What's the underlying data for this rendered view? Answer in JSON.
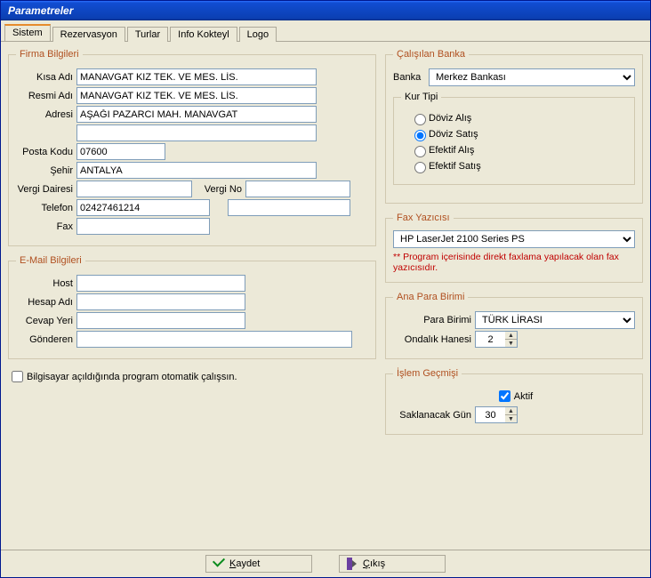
{
  "window": {
    "title": "Parametreler"
  },
  "tabs": [
    "Sistem",
    "Rezervasyon",
    "Turlar",
    "Info Kokteyl",
    "Logo"
  ],
  "firma": {
    "legend": "Firma Bilgileri",
    "labels": {
      "kisa_adi": "Kısa Adı",
      "resmi_adi": "Resmi Adı",
      "adresi": "Adresi",
      "posta_kodu": "Posta Kodu",
      "sehir": "Şehir",
      "vergi_dairesi": "Vergi Dairesi",
      "vergi_no": "Vergi No",
      "telefon": "Telefon",
      "fax": "Fax"
    },
    "values": {
      "kisa_adi": "MANAVGAT KIZ TEK. VE MES. LİS.",
      "resmi_adi": "MANAVGAT KIZ TEK. VE MES. LİS.",
      "adresi1": "AŞAĞI PAZARCI MAH. MANAVGAT",
      "adresi2": "",
      "posta_kodu": "07600",
      "sehir": "ANTALYA",
      "vergi_dairesi": "",
      "vergi_no": "",
      "telefon1": "02427461214",
      "telefon2": "",
      "fax": ""
    }
  },
  "email": {
    "legend": "E-Mail Bilgileri",
    "labels": {
      "host": "Host",
      "hesap_adi": "Hesap Adı",
      "cevap_yeri": "Cevap Yeri",
      "gonderen": "Gönderen"
    },
    "values": {
      "host": "",
      "hesap_adi": "",
      "cevap_yeri": "",
      "gonderen": ""
    }
  },
  "autostart": {
    "label": "Bilgisayar açıldığında program otomatik çalışsın."
  },
  "banka": {
    "legend": "Çalışılan Banka",
    "label_banka": "Banka",
    "value": "Merkez Bankası",
    "kur_legend": "Kur Tipi",
    "options": {
      "doviz_alis": "Döviz Alış",
      "doviz_satis": "Döviz Satış",
      "efektif_alis": "Efektif Alış",
      "efektif_satis": "Efektif Satış"
    },
    "selected": "doviz_satis"
  },
  "fax_yazicisi": {
    "legend": "Fax Yazıcısı",
    "value": "HP LaserJet 2100 Series PS",
    "warning": "** Program içerisinde  direkt faxlama yapılacak olan fax yazıcısıdır."
  },
  "ana_para": {
    "legend": "Ana Para Birimi",
    "label_birim": "Para Birimi",
    "value_birim": "TÜRK LİRASI",
    "label_ondalik": "Ondalık Hanesi",
    "value_ondalik": "2"
  },
  "islem": {
    "legend": "İşlem  Geçmişi",
    "aktif": "Aktif",
    "label_gun": "Saklanacak Gün",
    "value_gun": "30"
  },
  "buttons": {
    "kaydet_prefix": "K",
    "kaydet_rest": "aydet",
    "cikis_prefix": "Ç",
    "cikis_rest": "ıkış"
  }
}
